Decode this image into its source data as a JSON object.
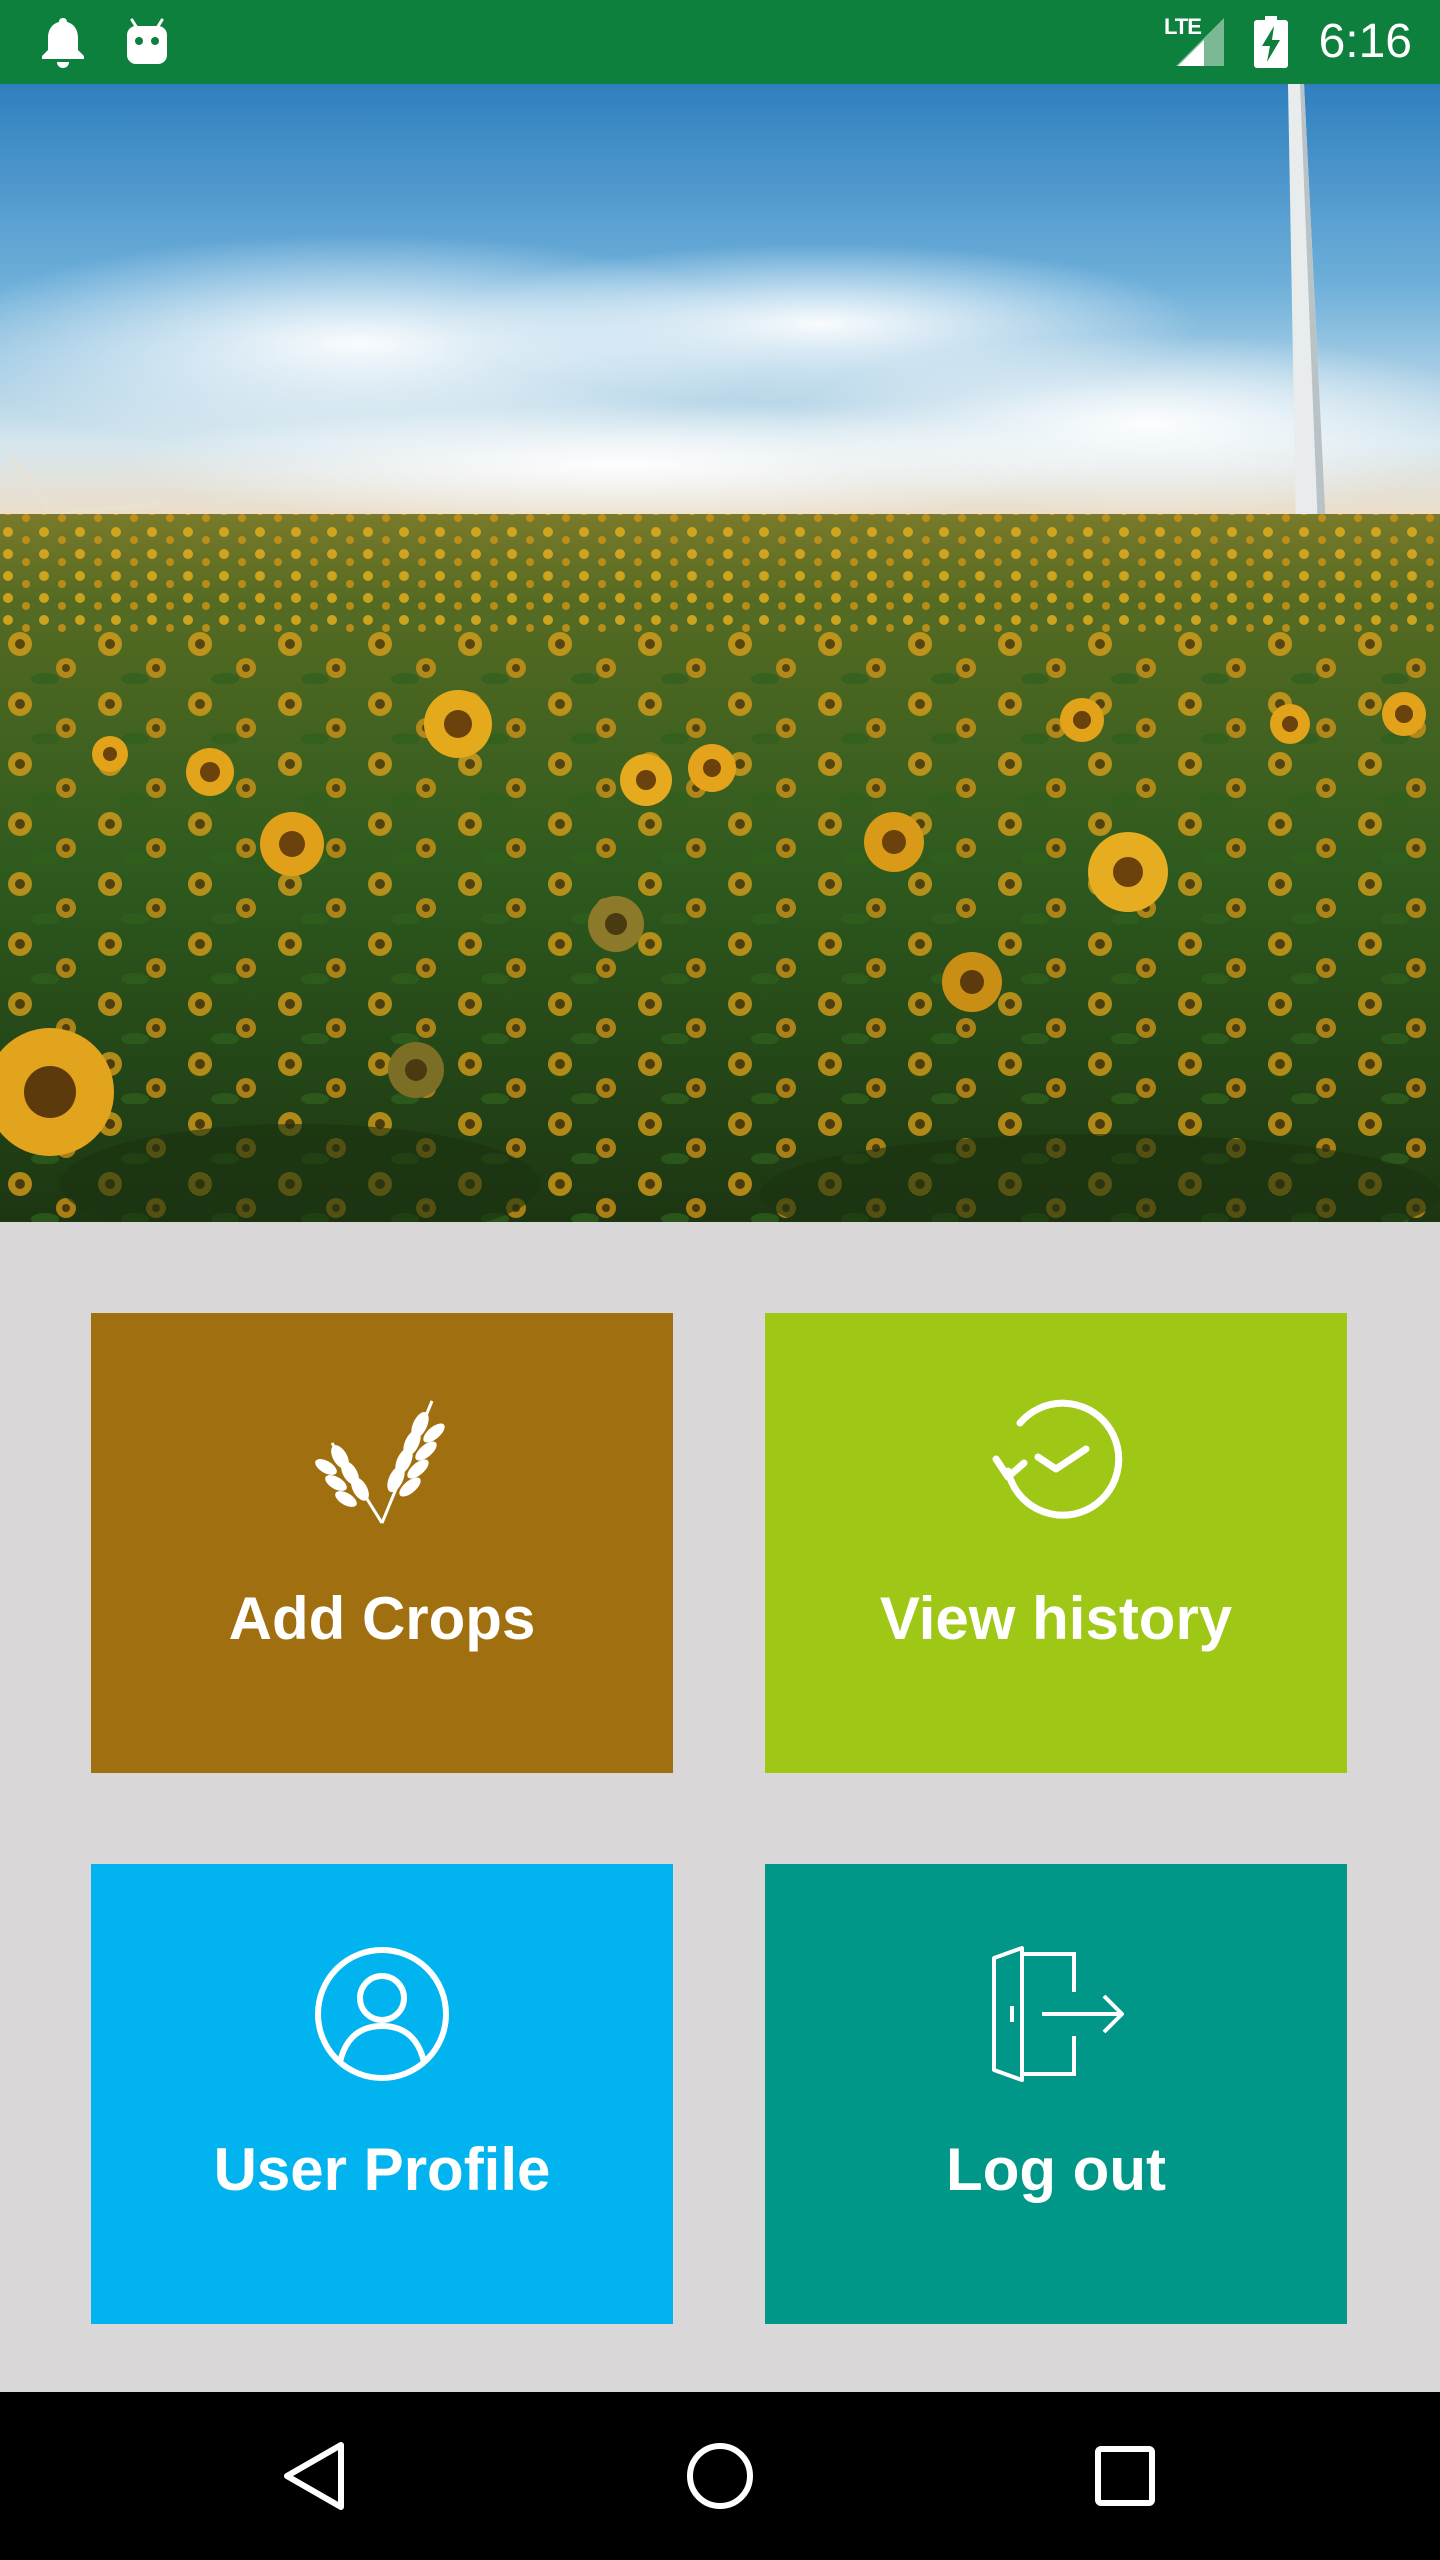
{
  "status_bar": {
    "time": "6:16",
    "network_type": "LTE",
    "icons": [
      "notification-bell-icon",
      "android-icon",
      "signal-icon",
      "battery-charging-icon"
    ]
  },
  "hero": {
    "image": "sunflower-field-photo"
  },
  "tiles": [
    {
      "label": "Add Crops",
      "icon": "wheat-icon",
      "color": "#a07010"
    },
    {
      "label": "View history",
      "icon": "history-clock-icon",
      "color": "#9fc716"
    },
    {
      "label": "User Profile",
      "icon": "user-icon",
      "color": "#01b3ee"
    },
    {
      "label": "Log out",
      "icon": "logout-door-icon",
      "color": "#009688"
    }
  ],
  "nav_bar": {
    "icons": [
      "back-icon",
      "home-icon",
      "recents-icon"
    ]
  },
  "colors": {
    "status_bar": "#0d803d",
    "background": "#d9d7d8",
    "nav_bar": "#000000"
  }
}
